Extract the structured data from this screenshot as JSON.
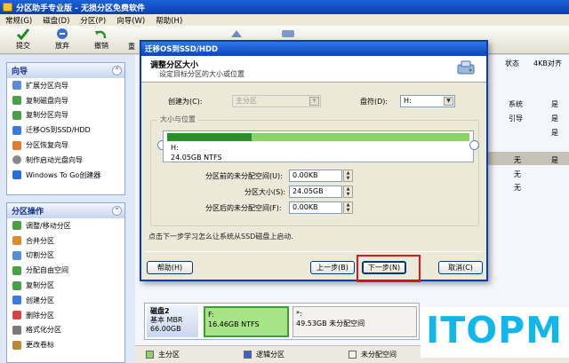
{
  "window": {
    "title": "分区助手专业版 - 无损分区免费软件",
    "menu": [
      "常规(G)",
      "磁盘(D)",
      "分区(P)",
      "向导(W)",
      "帮助(H)"
    ]
  },
  "toolbar": {
    "commit": "提交",
    "discard": "放弃",
    "undo": "撤销",
    "redo": "重"
  },
  "left_panel": {
    "wizard": {
      "title": "向导",
      "items": [
        "扩展分区向导",
        "复制磁盘向导",
        "复制分区向导",
        "迁移OS到SSD/HDD",
        "分区恢复向导",
        "制作启动光盘向导",
        "Windows To Go创建器"
      ]
    },
    "operations": {
      "title": "分区操作",
      "items": [
        "调整/移动分区",
        "合并分区",
        "切割分区",
        "分配自由空间",
        "复制分区",
        "创建分区",
        "删除分区",
        "格式化分区",
        "更改卷标"
      ]
    }
  },
  "right_area": {
    "columns": [
      "状态",
      "4KB对齐"
    ],
    "rows": [
      {
        "status": "系统",
        "align": "是"
      },
      {
        "status": "引导",
        "align": "是"
      },
      {
        "status": "",
        "align": "是"
      },
      {
        "status": "无",
        "align": "是"
      },
      {
        "status": "无",
        "align": ""
      },
      {
        "status": "无",
        "align": ""
      }
    ],
    "disk2": {
      "name": "磁盘2",
      "type": "基本 MBR",
      "size": "66.00GB",
      "partition_f": {
        "name": "F:",
        "desc": "16.46GB NTFS"
      },
      "partition_unalloc": {
        "name": "*:",
        "desc": "49.53GB 未分配空间"
      }
    },
    "legend": [
      "主分区",
      "逻辑分区",
      "未分配空间"
    ]
  },
  "dialog": {
    "title": "迁移OS到SSD/HDD",
    "header_title": "调整分区大小",
    "header_subtitle": "设定目标分区的大小或位置",
    "create_as_label": "创建为(C):",
    "create_as_value": "主分区",
    "drive_letter_label": "盘符(D):",
    "drive_letter_value": "H:",
    "size_position_label": "大小与位置",
    "partition": {
      "name": "H:",
      "desc": "24.05GB NTFS",
      "fill_fraction": 0.28
    },
    "unalloc_before_label": "分区前的未分配空间(U):",
    "unalloc_before_value": "0.00KB",
    "size_label": "分区大小(S):",
    "size_value": "24.05GB",
    "unalloc_after_label": "分区后的未分配空间(F):",
    "unalloc_after_value": "0.00KB",
    "hint": "点击下一步学习怎么让系统从SSD磁盘上启动.",
    "help": "帮助(H)",
    "back": "上一步(B)",
    "next": "下一步(N)",
    "cancel": "取消(C)"
  },
  "watermark": "ITOPM"
}
